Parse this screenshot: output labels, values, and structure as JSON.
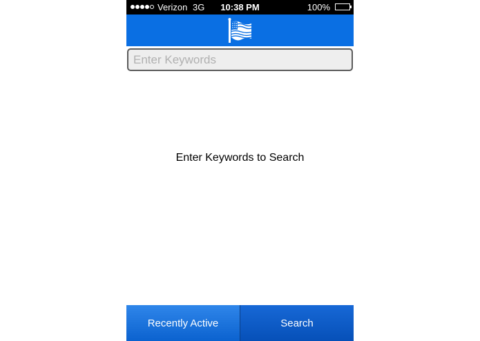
{
  "status_bar": {
    "carrier": "Verizon",
    "network": "3G",
    "time": "10:38 PM",
    "battery": "100%",
    "battery_level": 1.0,
    "signal_bars": 4,
    "signal_max": 5
  },
  "nav_bar": {
    "logo_icon": "american-flag-icon",
    "color": "#0a6fe3"
  },
  "search": {
    "placeholder": "Enter Keywords",
    "value": ""
  },
  "main": {
    "empty_message": "Enter Keywords to Search"
  },
  "tab_bar": {
    "tabs": [
      {
        "label": "Recently Active"
      },
      {
        "label": "Search"
      }
    ],
    "color": "#0b62cf"
  }
}
